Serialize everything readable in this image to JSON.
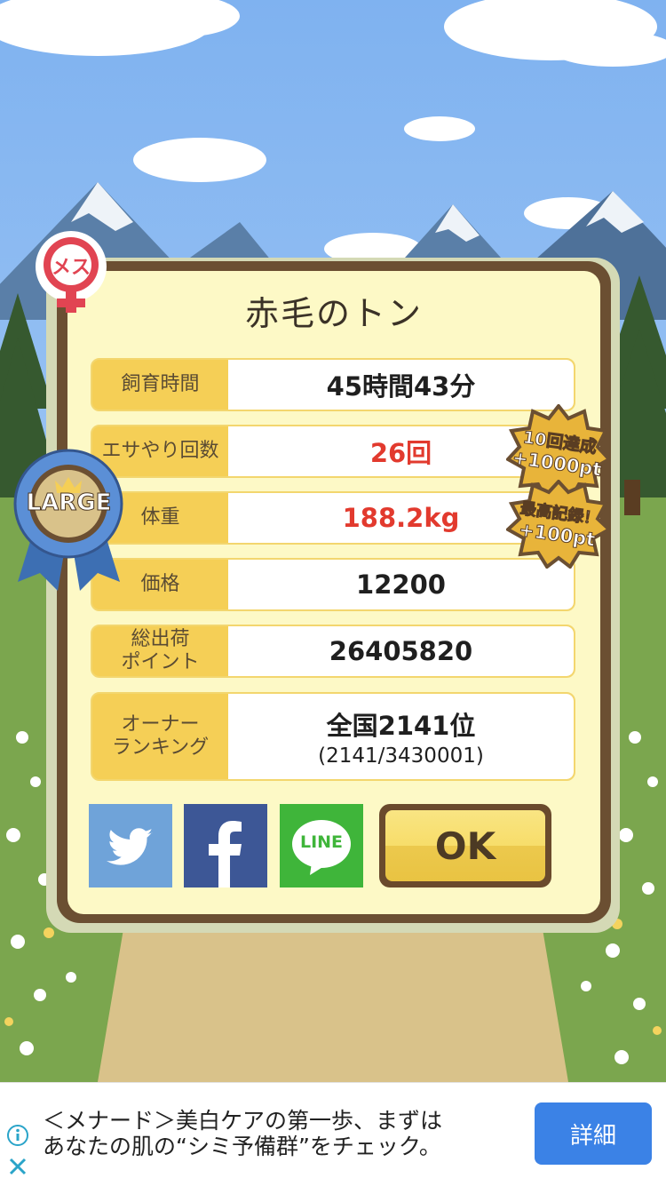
{
  "pet": {
    "name": "赤毛のトン",
    "gender_badge_text": "メス",
    "size_badge_text": "LARGE"
  },
  "stats": [
    {
      "label": "飼育時間",
      "value": "45時間43分"
    },
    {
      "label": "エサやり回数",
      "value": "26回"
    },
    {
      "label": "体重",
      "value": "188.2kg"
    },
    {
      "label": "価格",
      "value": "12200"
    },
    {
      "label_line1": "総出荷",
      "label_line2": "ポイント",
      "value": "26405820"
    },
    {
      "label_line1": "オーナー",
      "label_line2": "ランキング",
      "value": "全国2141位",
      "sub_value": "(2141/3430001)"
    }
  ],
  "bonuses": [
    {
      "line1": "10回達成",
      "line2": "+1000pt"
    },
    {
      "line1": "最高記録！",
      "line2": "+100pt"
    }
  ],
  "share": {
    "twitter_icon": "twitter-bird-icon",
    "facebook_icon": "facebook-f-icon",
    "line_icon": "line-speech-icon",
    "line_label": "LINE"
  },
  "ok_label": "OK",
  "ad": {
    "line1": "＜メナード＞美白ケアの第一歩、まずは",
    "line2": "あなたの肌の“シミ予備群”をチェック。",
    "button_label": "詳細"
  },
  "colors": {
    "panel_border": "#6b4f32",
    "panel_fill": "#fdf9c6",
    "label_fill": "#f5cf56",
    "highlight_red": "#e23a2e",
    "ok_button": "#f7dd6a",
    "ad_button": "#3b82e6"
  }
}
